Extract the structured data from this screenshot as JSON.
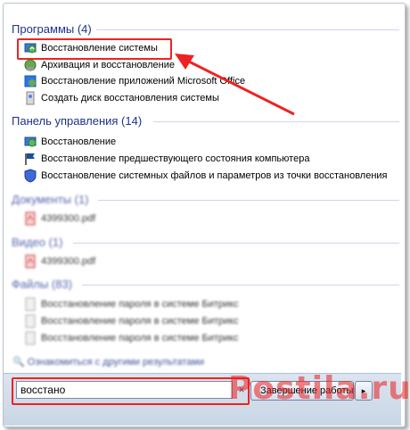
{
  "sections": {
    "programs": {
      "header": "Программы (4)",
      "items": [
        {
          "label": "Восстановление системы",
          "icon": "system-restore-icon"
        },
        {
          "label": "Архивация и восстановление",
          "icon": "backup-icon"
        },
        {
          "label": "Восстановление приложений Microsoft Office",
          "icon": "office-recovery-icon"
        },
        {
          "label": "Создать диск восстановления системы",
          "icon": "disc-icon"
        }
      ]
    },
    "control_panel": {
      "header": "Панель управления (14)",
      "items": [
        {
          "label": "Восстановление",
          "icon": "system-restore-icon"
        },
        {
          "label": "Восстановление предшествующего состояния компьютера",
          "icon": "flag-icon"
        },
        {
          "label": "Восстановление системных файлов и параметров из точки восстановления",
          "icon": "shield-icon"
        }
      ]
    },
    "documents": {
      "header": "Документы (1)",
      "items": [
        {
          "label": "4399300.pdf",
          "icon": "pdf-icon"
        }
      ]
    },
    "video": {
      "header": "Видео (1)",
      "items": [
        {
          "label": "4399300.pdf",
          "icon": "pdf-icon"
        }
      ]
    },
    "files": {
      "header": "Файлы (83)",
      "items": [
        {
          "label": "Восстановление пароля в системе Битрикс",
          "icon": "file-icon"
        },
        {
          "label": "Восстановление пароля в системе Битрикс",
          "icon": "file-icon"
        },
        {
          "label": "Восстановление пароля в системе Битрикс",
          "icon": "file-icon"
        }
      ]
    }
  },
  "more_results": "Ознакомиться с другими результатами",
  "search": {
    "value": "восстано"
  },
  "shutdown": {
    "label": "Завершение работы",
    "arrow": "▸"
  },
  "watermark": "Postila.ru",
  "colors": {
    "highlight": "#e22222",
    "header": "#1e3287"
  }
}
